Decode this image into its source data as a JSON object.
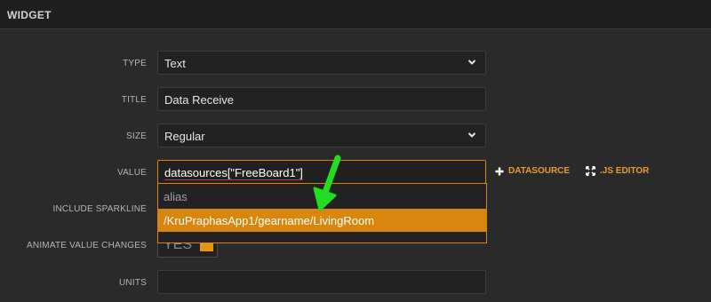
{
  "header": {
    "title": "WIDGET"
  },
  "fields": {
    "type": {
      "label": "TYPE",
      "value": "Text",
      "icon": "chevron-down-icon"
    },
    "title": {
      "label": "TITLE",
      "value": "Data Receive"
    },
    "size": {
      "label": "SIZE",
      "value": "Regular",
      "icon": "chevron-down-icon"
    },
    "value": {
      "label": "VALUE",
      "value": "datasources[\"FreeBoard1\"]"
    },
    "sparkline": {
      "label": "INCLUDE SPARKLINE"
    },
    "animate": {
      "label": "ANIMATE VALUE CHANGES",
      "toggle_text": "YES"
    },
    "units": {
      "label": "UNITS",
      "value": ""
    }
  },
  "actions": {
    "datasource": {
      "label": "DATASOURCE",
      "icon": "plus-icon"
    },
    "js_editor": {
      "label": ".JS EDITOR",
      "icon": "expand-icon"
    }
  },
  "dropdown": {
    "items": [
      {
        "label": "alias",
        "selected": false
      },
      {
        "label": "/KruPraphasApp1/gearname/LivingRoom",
        "selected": true
      }
    ]
  },
  "colors": {
    "accent": "#d8860e",
    "background": "#2a2a2a",
    "annotation_arrow": "#22dd22"
  }
}
